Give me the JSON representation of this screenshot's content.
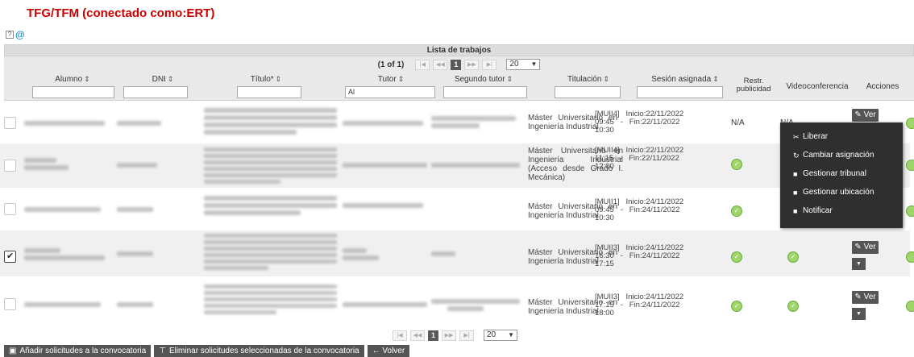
{
  "page": {
    "title": "TFG/TFM (conectado como:ERT)"
  },
  "toolbar": {
    "help_icon_label": "?",
    "at_icon_label": "@"
  },
  "table": {
    "caption": "Lista de trabajos",
    "pager": {
      "count": "(1 of 1)",
      "first": "|◀",
      "prev": "◀◀",
      "page": "1",
      "next": "▶▶",
      "last": "▶|",
      "rows_per_page": "20"
    },
    "columns": {
      "alumno": "Alumno",
      "dni": "DNI",
      "titulo": "Título*",
      "tutor": "Tutor",
      "segundo_tutor": "Segundo tutor",
      "titulacion": "Titulación",
      "sesion": "Sesión asignada",
      "restr": "Restr. publicidad",
      "video": "Videoconferencia",
      "acciones": "Acciones",
      "sort_glyph": "⇕"
    },
    "filters": {
      "tutor_value": "Al"
    },
    "rows": [
      {
        "titulacion": "Máster   Universitario   en Ingeniería Industrial",
        "sesion": "[MUII4]   Inicio:22/11/2022\n09:45   -   Fin:22/11/2022\n10:30",
        "restr": "N/A",
        "video": "N/A",
        "checked": false
      },
      {
        "titulacion": "Máster   Universitario   en Ingeniería Industrial (Acceso desde Grado I. Mecánica)",
        "sesion": "[MUII4]   Inicio:22/11/2022\n11:15   -   Fin:22/11/2022\n12:00",
        "restr": "",
        "video": "N",
        "checked": false
      },
      {
        "titulacion": "Máster   Universitario   en Ingeniería Industrial",
        "sesion": "[MUII1]   Inicio:24/11/2022\n09:45   -   Fin:24/11/2022\n10:30",
        "restr": "",
        "video": "",
        "checked": false
      },
      {
        "titulacion": "Máster   Universitario   en Ingeniería Industrial",
        "sesion": "[MUII3]   Inicio:24/11/2022\n16:30   -   Fin:24/11/2022\n17:15",
        "restr": "",
        "video": "",
        "checked": true
      },
      {
        "titulacion": "Máster   Universitario   en Ingeniería Industrial",
        "sesion": "[MUII3]   Inicio:24/11/2022\n17:15   -   Fin:24/11/2022\n18:00",
        "restr": "",
        "video": "",
        "checked": false
      }
    ],
    "ver_label": "Ver",
    "ver_icon": "pencil-icon",
    "more_icon": "caret-down-icon"
  },
  "context_menu": {
    "items": [
      {
        "label": "Liberar",
        "icon": "scissors-icon"
      },
      {
        "label": "Cambiar asignación",
        "icon": "refresh-icon"
      },
      {
        "label": "Gestionar tribunal",
        "icon": "book-icon"
      },
      {
        "label": "Gestionar ubicación",
        "icon": "book-icon"
      },
      {
        "label": "Notificar",
        "icon": "book-icon"
      }
    ]
  },
  "footer": {
    "add_label": "Añadir solicitudes a la convocatoria",
    "remove_label": "Eliminar solicitudes seleccionadas de la convocatoria",
    "back_label": "← Volver"
  },
  "colors": {
    "title": "#cc0000",
    "button": "#555555",
    "menu": "#2f2f2f",
    "ok": "#9fd56b"
  }
}
